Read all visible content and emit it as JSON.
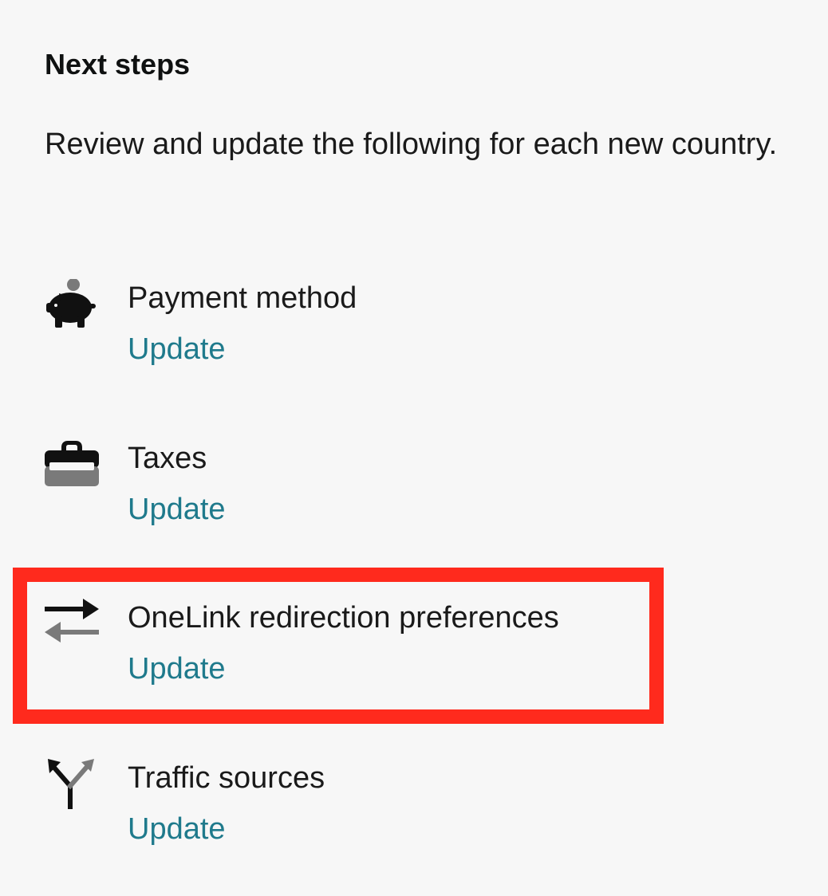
{
  "panel": {
    "heading": "Next steps",
    "intro": "Review and update the following for each new country."
  },
  "steps": [
    {
      "icon": "piggy-bank-icon",
      "title": "Payment method",
      "link_label": "Update"
    },
    {
      "icon": "toolbox-icon",
      "title": "Taxes",
      "link_label": "Update"
    },
    {
      "icon": "swap-arrows-icon",
      "title": "OneLink redirection preferences",
      "link_label": "Update",
      "highlighted": true
    },
    {
      "icon": "split-arrows-icon",
      "title": "Traffic sources",
      "link_label": "Update"
    }
  ],
  "colors": {
    "background": "#f7f7f7",
    "text": "#1a1a1a",
    "link": "#1f7a8c",
    "highlight": "#ff2a1d",
    "icon_dark": "#111111",
    "icon_gray": "#7a7a7a"
  }
}
